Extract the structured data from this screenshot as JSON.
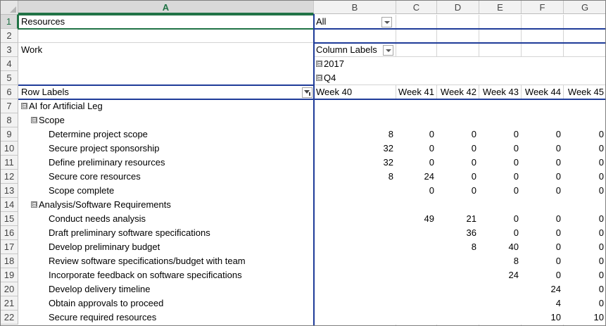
{
  "columns": [
    "A",
    "B",
    "C",
    "D",
    "E",
    "F",
    "G"
  ],
  "rows": [
    "1",
    "2",
    "3",
    "4",
    "5",
    "6",
    "7",
    "8",
    "9",
    "10",
    "11",
    "12",
    "13",
    "14",
    "15",
    "16",
    "17",
    "18",
    "19",
    "20",
    "21",
    "22"
  ],
  "filter": {
    "label": "Resources",
    "value": "All"
  },
  "values_label": "Work",
  "column_labels": "Column Labels",
  "row_labels": "Row Labels",
  "year": "2017",
  "quarter": "Q4",
  "toggle_symbol": "⊟",
  "weeks": [
    "Week 40",
    "Week 41",
    "Week 42",
    "Week 43",
    "Week 44",
    "Week 45"
  ],
  "tree": [
    {
      "label": "AI for Artificial Leg",
      "level": 0,
      "values": [
        "",
        "",
        "",
        "",
        "",
        ""
      ]
    },
    {
      "label": "Scope",
      "level": 1,
      "values": [
        "",
        "",
        "",
        "",
        "",
        ""
      ]
    },
    {
      "label": "Determine project scope",
      "level": 2,
      "values": [
        "8",
        "0",
        "0",
        "0",
        "0",
        "0"
      ]
    },
    {
      "label": "Secure project sponsorship",
      "level": 2,
      "values": [
        "32",
        "0",
        "0",
        "0",
        "0",
        "0"
      ]
    },
    {
      "label": "Define preliminary resources",
      "level": 2,
      "values": [
        "32",
        "0",
        "0",
        "0",
        "0",
        "0"
      ]
    },
    {
      "label": "Secure core resources",
      "level": 2,
      "values": [
        "8",
        "24",
        "0",
        "0",
        "0",
        "0"
      ]
    },
    {
      "label": "Scope complete",
      "level": 2,
      "values": [
        "",
        "0",
        "0",
        "0",
        "0",
        "0"
      ]
    },
    {
      "label": "Analysis/Software Requirements",
      "level": 1,
      "values": [
        "",
        "",
        "",
        "",
        "",
        ""
      ]
    },
    {
      "label": "Conduct needs analysis",
      "level": 2,
      "values": [
        "",
        "49",
        "21",
        "0",
        "0",
        "0"
      ]
    },
    {
      "label": "Draft preliminary software specifications",
      "level": 2,
      "values": [
        "",
        "",
        "36",
        "0",
        "0",
        "0"
      ]
    },
    {
      "label": "Develop preliminary budget",
      "level": 2,
      "values": [
        "",
        "",
        "8",
        "40",
        "0",
        "0"
      ]
    },
    {
      "label": "Review software specifications/budget with team",
      "level": 2,
      "values": [
        "",
        "",
        "",
        "8",
        "0",
        "0"
      ]
    },
    {
      "label": "Incorporate feedback on software specifications",
      "level": 2,
      "values": [
        "",
        "",
        "",
        "24",
        "0",
        "0"
      ]
    },
    {
      "label": "Develop delivery timeline",
      "level": 2,
      "values": [
        "",
        "",
        "",
        "",
        "24",
        "0"
      ]
    },
    {
      "label": "Obtain approvals to proceed",
      "level": 2,
      "values": [
        "",
        "",
        "",
        "",
        "4",
        "0"
      ]
    },
    {
      "label": "Secure required resources",
      "level": 2,
      "values": [
        "",
        "",
        "",
        "",
        "10",
        "10"
      ]
    }
  ]
}
